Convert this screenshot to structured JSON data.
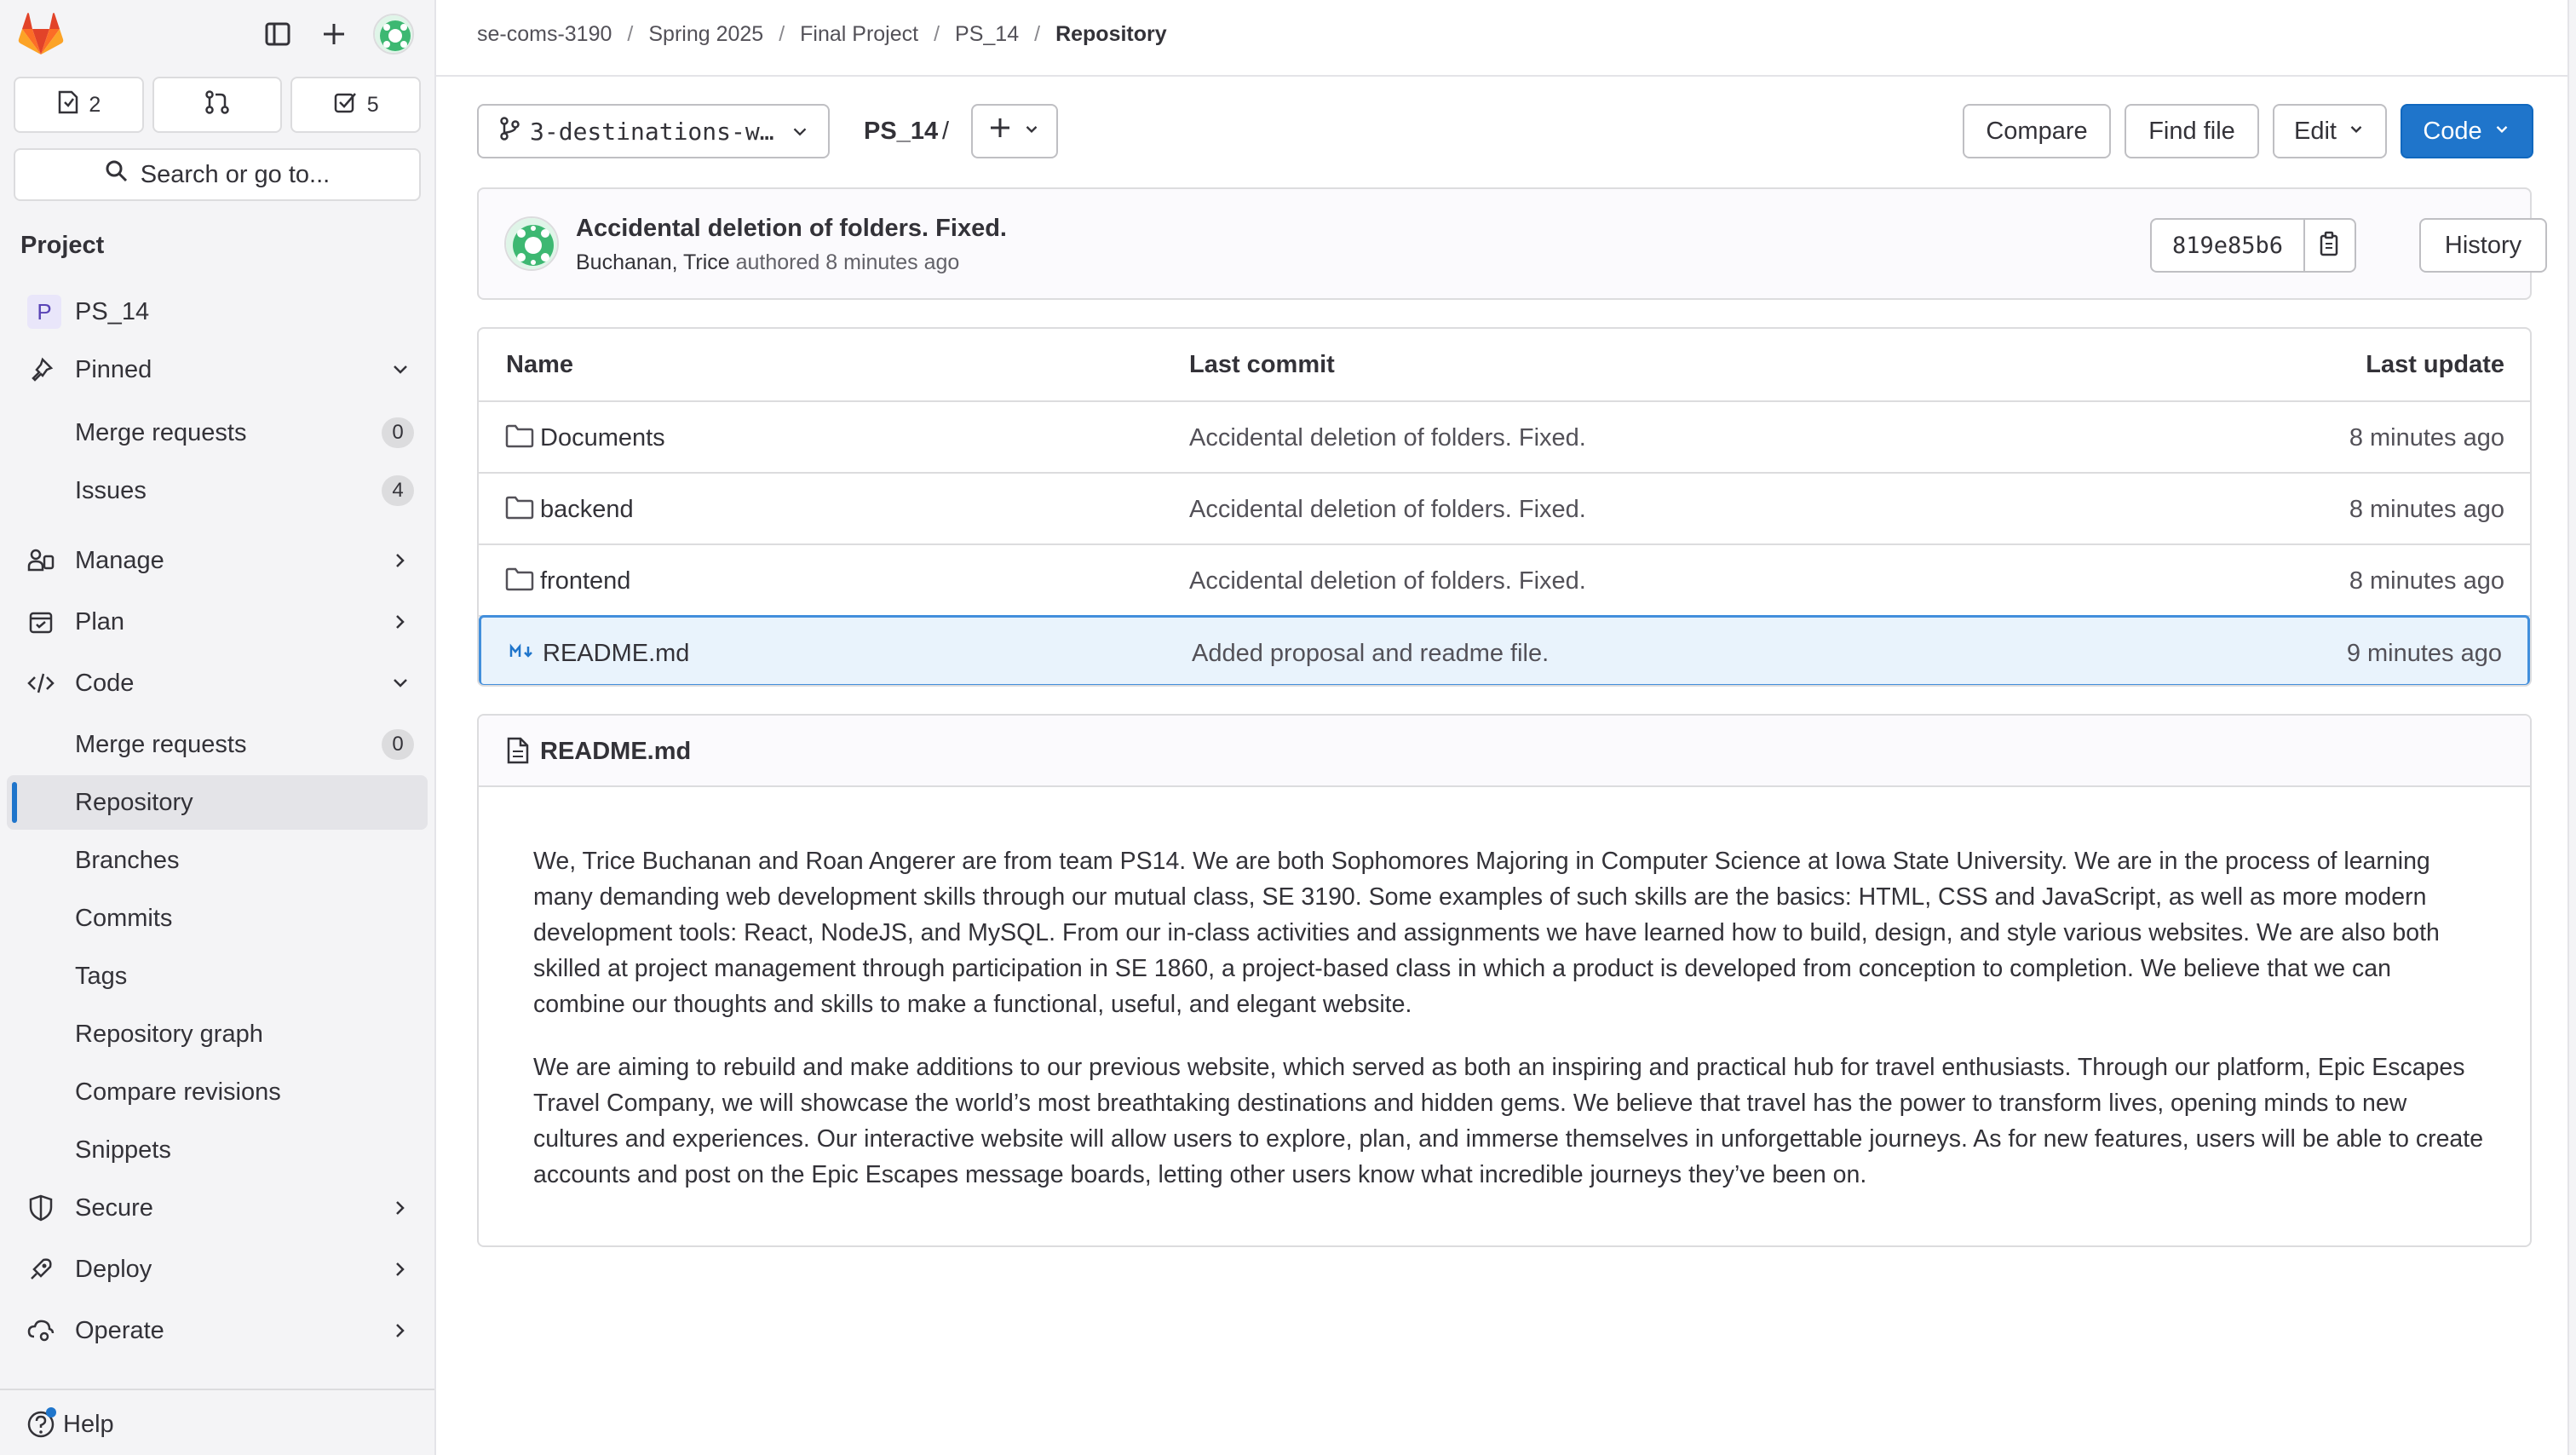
{
  "colors": {
    "accent": "#1f75cb",
    "logo_orange": "#e24329",
    "logo_light": "#fca326",
    "logo_mid": "#fc6d26"
  },
  "sidebar": {
    "counters": [
      {
        "icon": "issues-icon",
        "value": "2"
      },
      {
        "icon": "merge-request-icon",
        "value": ""
      },
      {
        "icon": "todo-icon",
        "value": "5"
      }
    ],
    "search_label": "Search or go to...",
    "section_title": "Project",
    "project": {
      "letter": "P",
      "name": "PS_14"
    },
    "pinned": {
      "label": "Pinned"
    },
    "pinned_items": [
      {
        "label": "Merge requests",
        "badge": "0"
      },
      {
        "label": "Issues",
        "badge": "4"
      }
    ],
    "manage": "Manage",
    "plan": "Plan",
    "code": "Code",
    "code_items": [
      {
        "label": "Merge requests",
        "badge": "0"
      },
      {
        "label": "Repository"
      },
      {
        "label": "Branches"
      },
      {
        "label": "Commits"
      },
      {
        "label": "Tags"
      },
      {
        "label": "Repository graph"
      },
      {
        "label": "Compare revisions"
      },
      {
        "label": "Snippets"
      }
    ],
    "secure": "Secure",
    "deploy": "Deploy",
    "operate": "Operate",
    "help": "Help"
  },
  "breadcrumb": [
    "se-coms-3190",
    "Spring 2025",
    "Final Project",
    "PS_14",
    "Repository"
  ],
  "toolbar": {
    "branch": "3-destinations-w…",
    "path": "PS_14",
    "path_sep": "/",
    "compare": "Compare",
    "find_file": "Find file",
    "edit": "Edit",
    "code": "Code"
  },
  "commit": {
    "title": "Accidental deletion of folders. Fixed.",
    "author": "Buchanan, Trice",
    "authored": "authored 8 minutes ago",
    "sha": "819e85b6",
    "history": "History"
  },
  "table": {
    "headers": {
      "name": "Name",
      "last_commit": "Last commit",
      "last_update": "Last update"
    },
    "rows": [
      {
        "name": "Documents",
        "type": "folder",
        "commit": "Accidental deletion of folders. Fixed.",
        "updated": "8 minutes ago"
      },
      {
        "name": "backend",
        "type": "folder",
        "commit": "Accidental deletion of folders. Fixed.",
        "updated": "8 minutes ago"
      },
      {
        "name": "frontend",
        "type": "folder",
        "commit": "Accidental deletion of folders. Fixed.",
        "updated": "8 minutes ago"
      },
      {
        "name": "README.md",
        "type": "markdown",
        "commit": "Added proposal and readme file.",
        "updated": "9 minutes ago"
      }
    ]
  },
  "readme": {
    "title": "README.md",
    "paragraphs": [
      "We, Trice Buchanan and Roan Angerer are from team PS14. We are both Sophomores Majoring in Computer Science at Iowa State University. We are in the process of learning many demanding web development skills through our mutual class, SE 3190. Some examples of such skills are the basics: HTML, CSS and JavaScript, as well as more modern development tools: React, NodeJS, and MySQL. From our in-class activities and assignments we have learned how to build, design, and style various websites. We are also both skilled at project management through participation in SE 1860, a project-based class in which a product is developed from conception to completion. We believe that we can combine our thoughts and skills to make a functional, useful, and elegant website.",
      "We are aiming to rebuild and make additions to our previous website, which served as both an inspiring and practical hub for travel enthusiasts. Through our platform, Epic Escapes Travel Company, we will showcase the world’s most breathtaking destinations and hidden gems. We believe that travel has the power to transform lives, opening minds to new cultures and experiences. Our interactive website will allow users to explore, plan, and immerse themselves in unforgettable journeys. As for new features, users will be able to create accounts and post on the Epic Escapes message boards, letting other users know what incredible journeys they’ve been on."
    ]
  }
}
